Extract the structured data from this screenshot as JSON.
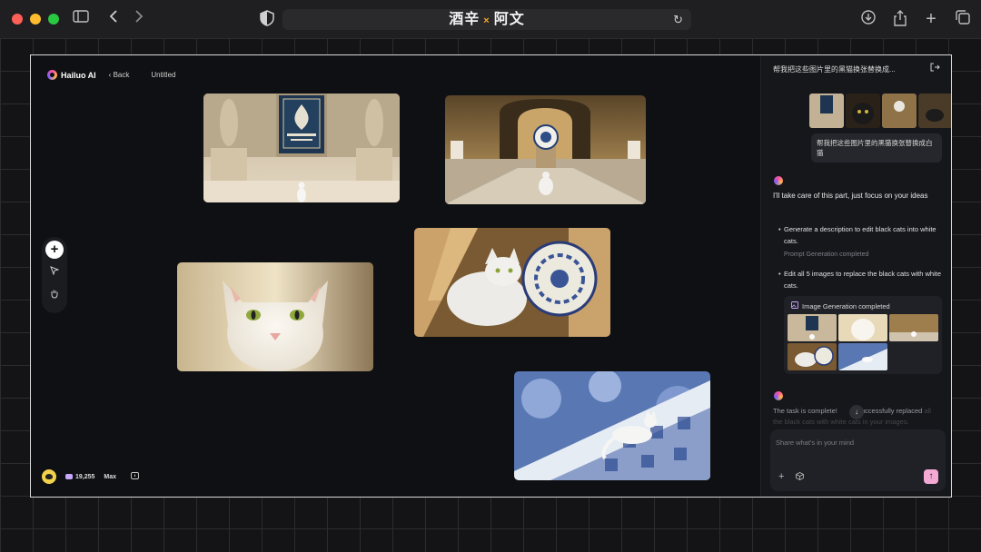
{
  "browser": {
    "address_title": "酒辛",
    "address_x": "×",
    "address_title2": "阿文"
  },
  "app": {
    "logo_text": "Hailuo AI",
    "back_label": "Back",
    "doc_title": "Untitled"
  },
  "bottom": {
    "credits": "19,255",
    "plan": "Max"
  },
  "panel": {
    "title": "帮我把这些图片里的黑猫换张替换成...",
    "user_message": "帮我把这些图片里的黑猫换张替换成白猫",
    "ai_intro": "I'll take care of this part, just focus on your ideas",
    "step1": "Generate a description to edit black cats into white cats.",
    "step1_status": "Prompt Generation completed",
    "step2": "Edit all 5 images to replace the black cats with white cats.",
    "step2_status": "Image Generation completed",
    "ai_done_a": "The task is complete!",
    "ai_done_b": "successfully replaced",
    "ai_done_c": "all the black cats with white cats in your images.",
    "input_placeholder": "Share what's in your mind"
  },
  "colors": {
    "accent": "#f4a9d4",
    "frame_border": "#d9d9d9"
  }
}
